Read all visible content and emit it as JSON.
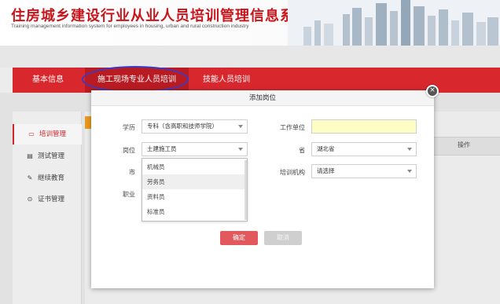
{
  "header": {
    "title": "住房城乡建设行业从业人员培训管理信息系统",
    "subtitle": "Training management information system for employees in housing, urban and rural construction industry"
  },
  "nav": {
    "items": [
      {
        "label": "基本信息"
      },
      {
        "label": "施工现场专业人员培训"
      },
      {
        "label": "技能人员培训"
      }
    ]
  },
  "sidebar": {
    "items": [
      {
        "label": "培训管理",
        "icon": "card-icon"
      },
      {
        "label": "测试管理",
        "icon": "document-icon"
      },
      {
        "label": "继续教育",
        "icon": "edit-icon"
      },
      {
        "label": "证书管理",
        "icon": "badge-icon"
      }
    ]
  },
  "background_table": {
    "column_action": "操作"
  },
  "modal": {
    "title": "添加岗位",
    "close_label": "×",
    "fields": {
      "education_label": "学历",
      "education_value": "专科（含高职和技师学院）",
      "position_label": "岗位",
      "position_value": "土建施工员",
      "city_label": "市",
      "occupation_label": "职业",
      "work_unit_label": "工作单位",
      "work_unit_value": "",
      "province_label": "省",
      "province_value": "湖北省",
      "training_org_label": "培训机构",
      "training_org_value": "请选择"
    },
    "position_dropdown": {
      "options": [
        "机械员",
        "劳务员",
        "资料员",
        "标准员"
      ],
      "hovered_option": "劳务员"
    },
    "confirm_label": "确定",
    "cancel_label": "取消"
  },
  "colors": {
    "brand_red": "#d9272e",
    "active_nav": "#b81c22",
    "annotation_ellipse": "#3a3ac8",
    "confirm_button": "#e2595d",
    "highlight_input": "#fdfdc4"
  }
}
